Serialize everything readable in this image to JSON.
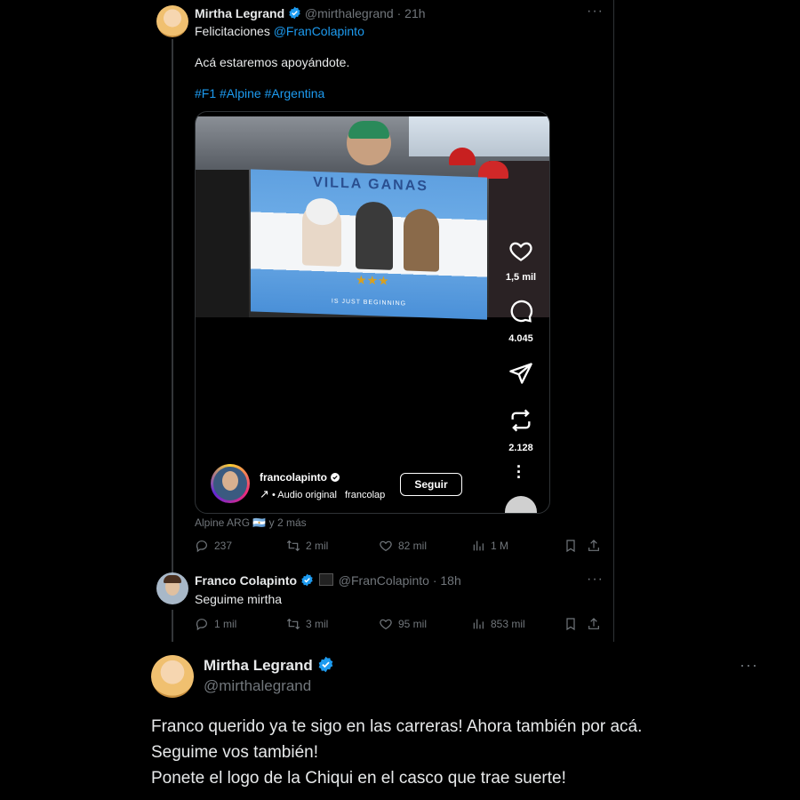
{
  "tweet1": {
    "name": "Mirtha Legrand",
    "handle_time": "@mirthalegrand · 21h",
    "line1_prefix": "Felicitaciones ",
    "mention": "@FranColapinto",
    "line2": "Acá estaremos apoyándote.",
    "hashtags": "#F1 #Alpine #Argentina",
    "flag_text": "VILLA GANAS",
    "flag_bottom": "IS JUST BEGINNING",
    "reel": {
      "likes": "1,5 mil",
      "comments": "4.045",
      "reposts": "2.128",
      "user": "francolapinto",
      "audio": "Audio original",
      "audio_user": "francolap",
      "follow_label": "Seguir"
    },
    "tags": "Alpine ARG 🇦🇷  y 2 más",
    "stats": {
      "replies": "237",
      "retweets": "2 mil",
      "likes": "82 mil",
      "views": "1 M"
    }
  },
  "tweet2": {
    "name": "Franco Colapinto",
    "handle_time": "@FranColapinto · 18h",
    "text": "Seguime mirtha",
    "stats": {
      "replies": "1 mil",
      "retweets": "3 mil",
      "likes": "95 mil",
      "views": "853 mil"
    }
  },
  "tweet3": {
    "name": "Mirtha Legrand",
    "handle": "@mirthalegrand",
    "line1": "Franco querido ya te sigo en las carreras! Ahora también por acá.",
    "line2": "Seguime vos también!",
    "line3": "Ponete el logo de la Chiqui en el casco que trae suerte!"
  },
  "icons": [
    "verified-badge-icon",
    "more-icon",
    "reply-icon",
    "retweet-icon",
    "like-icon",
    "views-icon",
    "bookmark-icon",
    "share-icon",
    "heart-icon",
    "comment-icon",
    "send-icon",
    "repost-icon",
    "arrow-icon"
  ],
  "colors": {
    "accent": "#1d9bf0",
    "muted": "#71767b",
    "background": "#000000"
  }
}
